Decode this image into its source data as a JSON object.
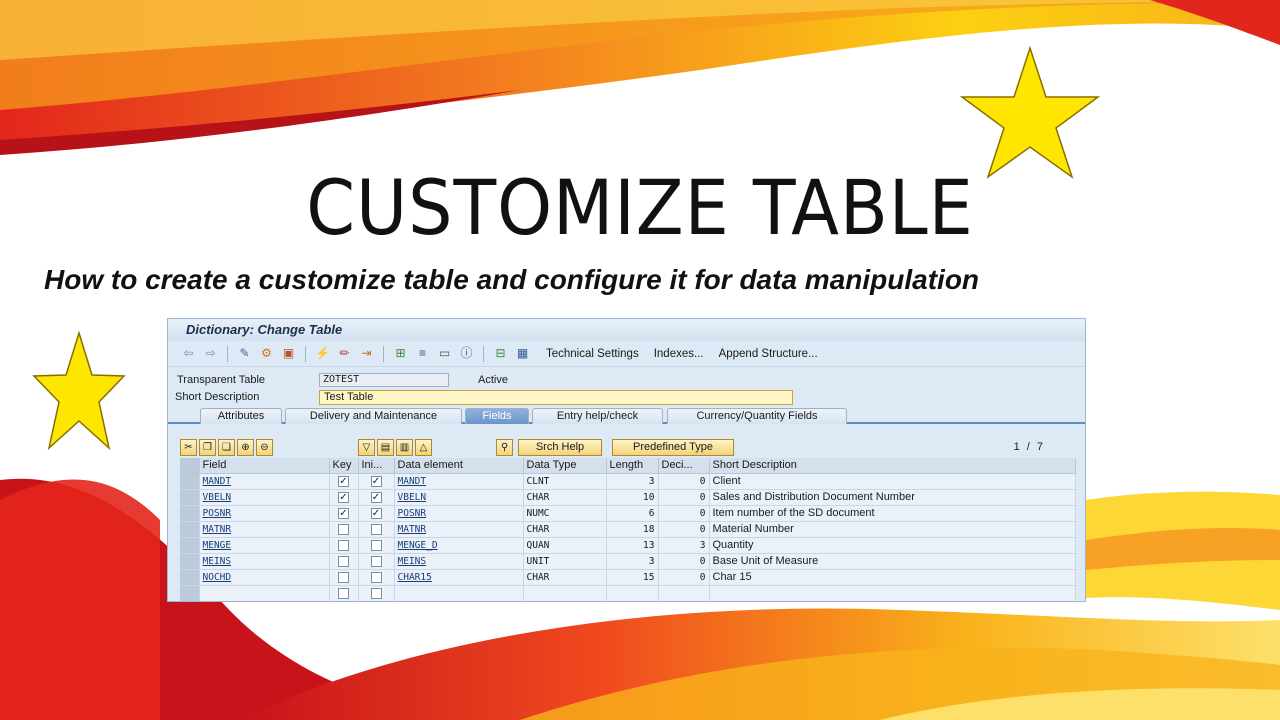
{
  "slide": {
    "title": "CUSTOMIZE TABLE",
    "subtitle": "How to create a customize table and configure it for data manipulation"
  },
  "sap": {
    "window_title": "Dictionary: Change Table",
    "toolbar": {
      "technical_settings": "Technical Settings",
      "indexes": "Indexes...",
      "append_structure": "Append Structure..."
    },
    "header": {
      "transparent_table_label": "Transparent Table",
      "transparent_table_value": "ZOTEST",
      "status": "Active",
      "short_description_label": "Short Description",
      "short_description_value": "Test Table"
    },
    "tabs": [
      "Attributes",
      "Delivery and Maintenance",
      "Fields",
      "Entry help/check",
      "Currency/Quantity Fields"
    ],
    "active_tab": "Fields",
    "grid_toolbar": {
      "srch_help": "Srch Help",
      "predefined_type": "Predefined Type",
      "page_indicator": "1 / 7"
    },
    "columns": [
      "Field",
      "Key",
      "Ini...",
      "Data element",
      "Data Type",
      "Length",
      "Deci...",
      "Short Description"
    ],
    "rows": [
      {
        "field": "MANDT",
        "key": true,
        "ini": true,
        "data_element": "MANDT",
        "data_type": "CLNT",
        "length": "3",
        "deci": "0",
        "desc": "Client"
      },
      {
        "field": "VBELN",
        "key": true,
        "ini": true,
        "data_element": "VBELN",
        "data_type": "CHAR",
        "length": "10",
        "deci": "0",
        "desc": "Sales and Distribution Document Number"
      },
      {
        "field": "POSNR",
        "key": true,
        "ini": true,
        "data_element": "POSNR",
        "data_type": "NUMC",
        "length": "6",
        "deci": "0",
        "desc": "Item number of the SD document"
      },
      {
        "field": "MATNR",
        "key": false,
        "ini": false,
        "data_element": "MATNR",
        "data_type": "CHAR",
        "length": "18",
        "deci": "0",
        "desc": "Material Number"
      },
      {
        "field": "MENGE",
        "key": false,
        "ini": false,
        "data_element": "MENGE_D",
        "data_type": "QUAN",
        "length": "13",
        "deci": "3",
        "desc": "Quantity"
      },
      {
        "field": "MEINS",
        "key": false,
        "ini": false,
        "data_element": "MEINS",
        "data_type": "UNIT",
        "length": "3",
        "deci": "0",
        "desc": "Base Unit of Measure"
      },
      {
        "field": "NOCHD",
        "key": false,
        "ini": false,
        "data_element": "CHAR15",
        "data_type": "CHAR",
        "length": "15",
        "deci": "0",
        "desc": "Char 15"
      },
      {
        "field": "",
        "key": false,
        "ini": false,
        "data_element": "",
        "data_type": "",
        "length": "",
        "deci": "",
        "desc": ""
      }
    ]
  },
  "colors": {
    "swoosh_red": "#e3261c",
    "swoosh_orange": "#f58a1f",
    "swoosh_yellow": "#fcd012",
    "star_fill": "#ffe600"
  }
}
